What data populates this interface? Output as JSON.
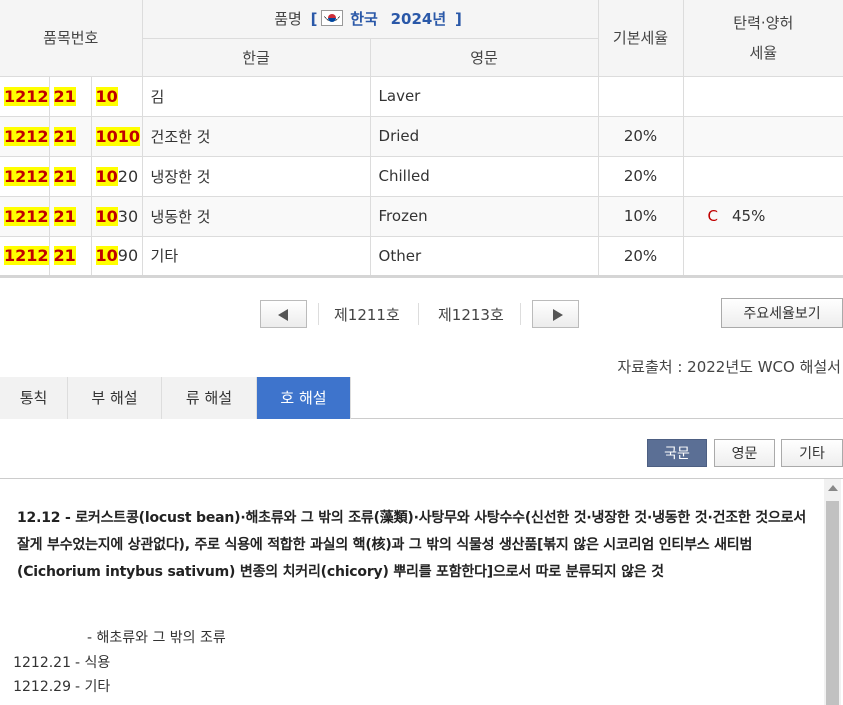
{
  "table": {
    "headers": {
      "hsn": "품목번호",
      "name": "품명",
      "bracket_open": "[",
      "country": "한국",
      "year": "2024년",
      "bracket_close": "]",
      "korean": "한글",
      "english": "영문",
      "basic_rate": "기본세율",
      "flex_rate_line1": "탄력·양허",
      "flex_rate_line2": "세율"
    },
    "rows": [
      {
        "c1": "1212",
        "c2": "21",
        "c3_hl": "10",
        "c3_rest": "",
        "korean": "김",
        "english": "Laver",
        "basic_rate": "",
        "flex_tag": "",
        "flex_rate": ""
      },
      {
        "c1": "1212",
        "c2": "21",
        "c3_hl": "1010",
        "c3_rest": "",
        "korean": "건조한 것",
        "english": "Dried",
        "basic_rate": "20%",
        "flex_tag": "",
        "flex_rate": ""
      },
      {
        "c1": "1212",
        "c2": "21",
        "c3_hl": "10",
        "c3_rest": "20",
        "korean": "냉장한 것",
        "english": "Chilled",
        "basic_rate": "20%",
        "flex_tag": "",
        "flex_rate": ""
      },
      {
        "c1": "1212",
        "c2": "21",
        "c3_hl": "10",
        "c3_rest": "30",
        "korean": "냉동한 것",
        "english": "Frozen",
        "basic_rate": "10%",
        "flex_tag": "C",
        "flex_rate": "45%"
      },
      {
        "c1": "1212",
        "c2": "21",
        "c3_hl": "10",
        "c3_rest": "90",
        "korean": "기타",
        "english": "Other",
        "basic_rate": "20%",
        "flex_tag": "",
        "flex_rate": ""
      }
    ]
  },
  "pager": {
    "prev_label": "제1211호",
    "next_label": "제1213호",
    "major_rates_button": "주요세율보기"
  },
  "source": "자료출처 : 2022년도 WCO 해설서",
  "tabs": [
    {
      "label": "통칙"
    },
    {
      "label": "부 해설"
    },
    {
      "label": "류 해설"
    },
    {
      "label": "호 해설"
    }
  ],
  "lang_buttons": {
    "korean": "국문",
    "english": "영문",
    "other": "기타"
  },
  "content": {
    "heading": "12.12 - 로커스트콩(locust bean)·해초류와 그 밖의 조류(藻類)·사탕무와 사탕수수(신선한 것·냉장한 것·냉동한 것·건조한 것으로서 잘게 부수었는지에 상관없다), 주로 식용에 적합한 과실의 핵(核)과 그 밖의 식물성 생산품[볶지 않은 시코리엄 인티부스 새티범(Cichorium intybus sativum) 변종의 치커리(chicory) 뿌리를 포함한다]으로서 따로 분류되지 않은 것",
    "line1": "- 해초류와 그 밖의 조류",
    "line2_code": "1212.21",
    "line2_text": "- 식용",
    "line3_code": "1212.29",
    "line3_text": "- 기타"
  },
  "colors": {
    "highlight_bg": "#ffff00",
    "highlight_text": "#c00000",
    "active_tab": "#3e74cc",
    "active_lang": "#5b6f95",
    "header_blue": "#2a58a8"
  }
}
